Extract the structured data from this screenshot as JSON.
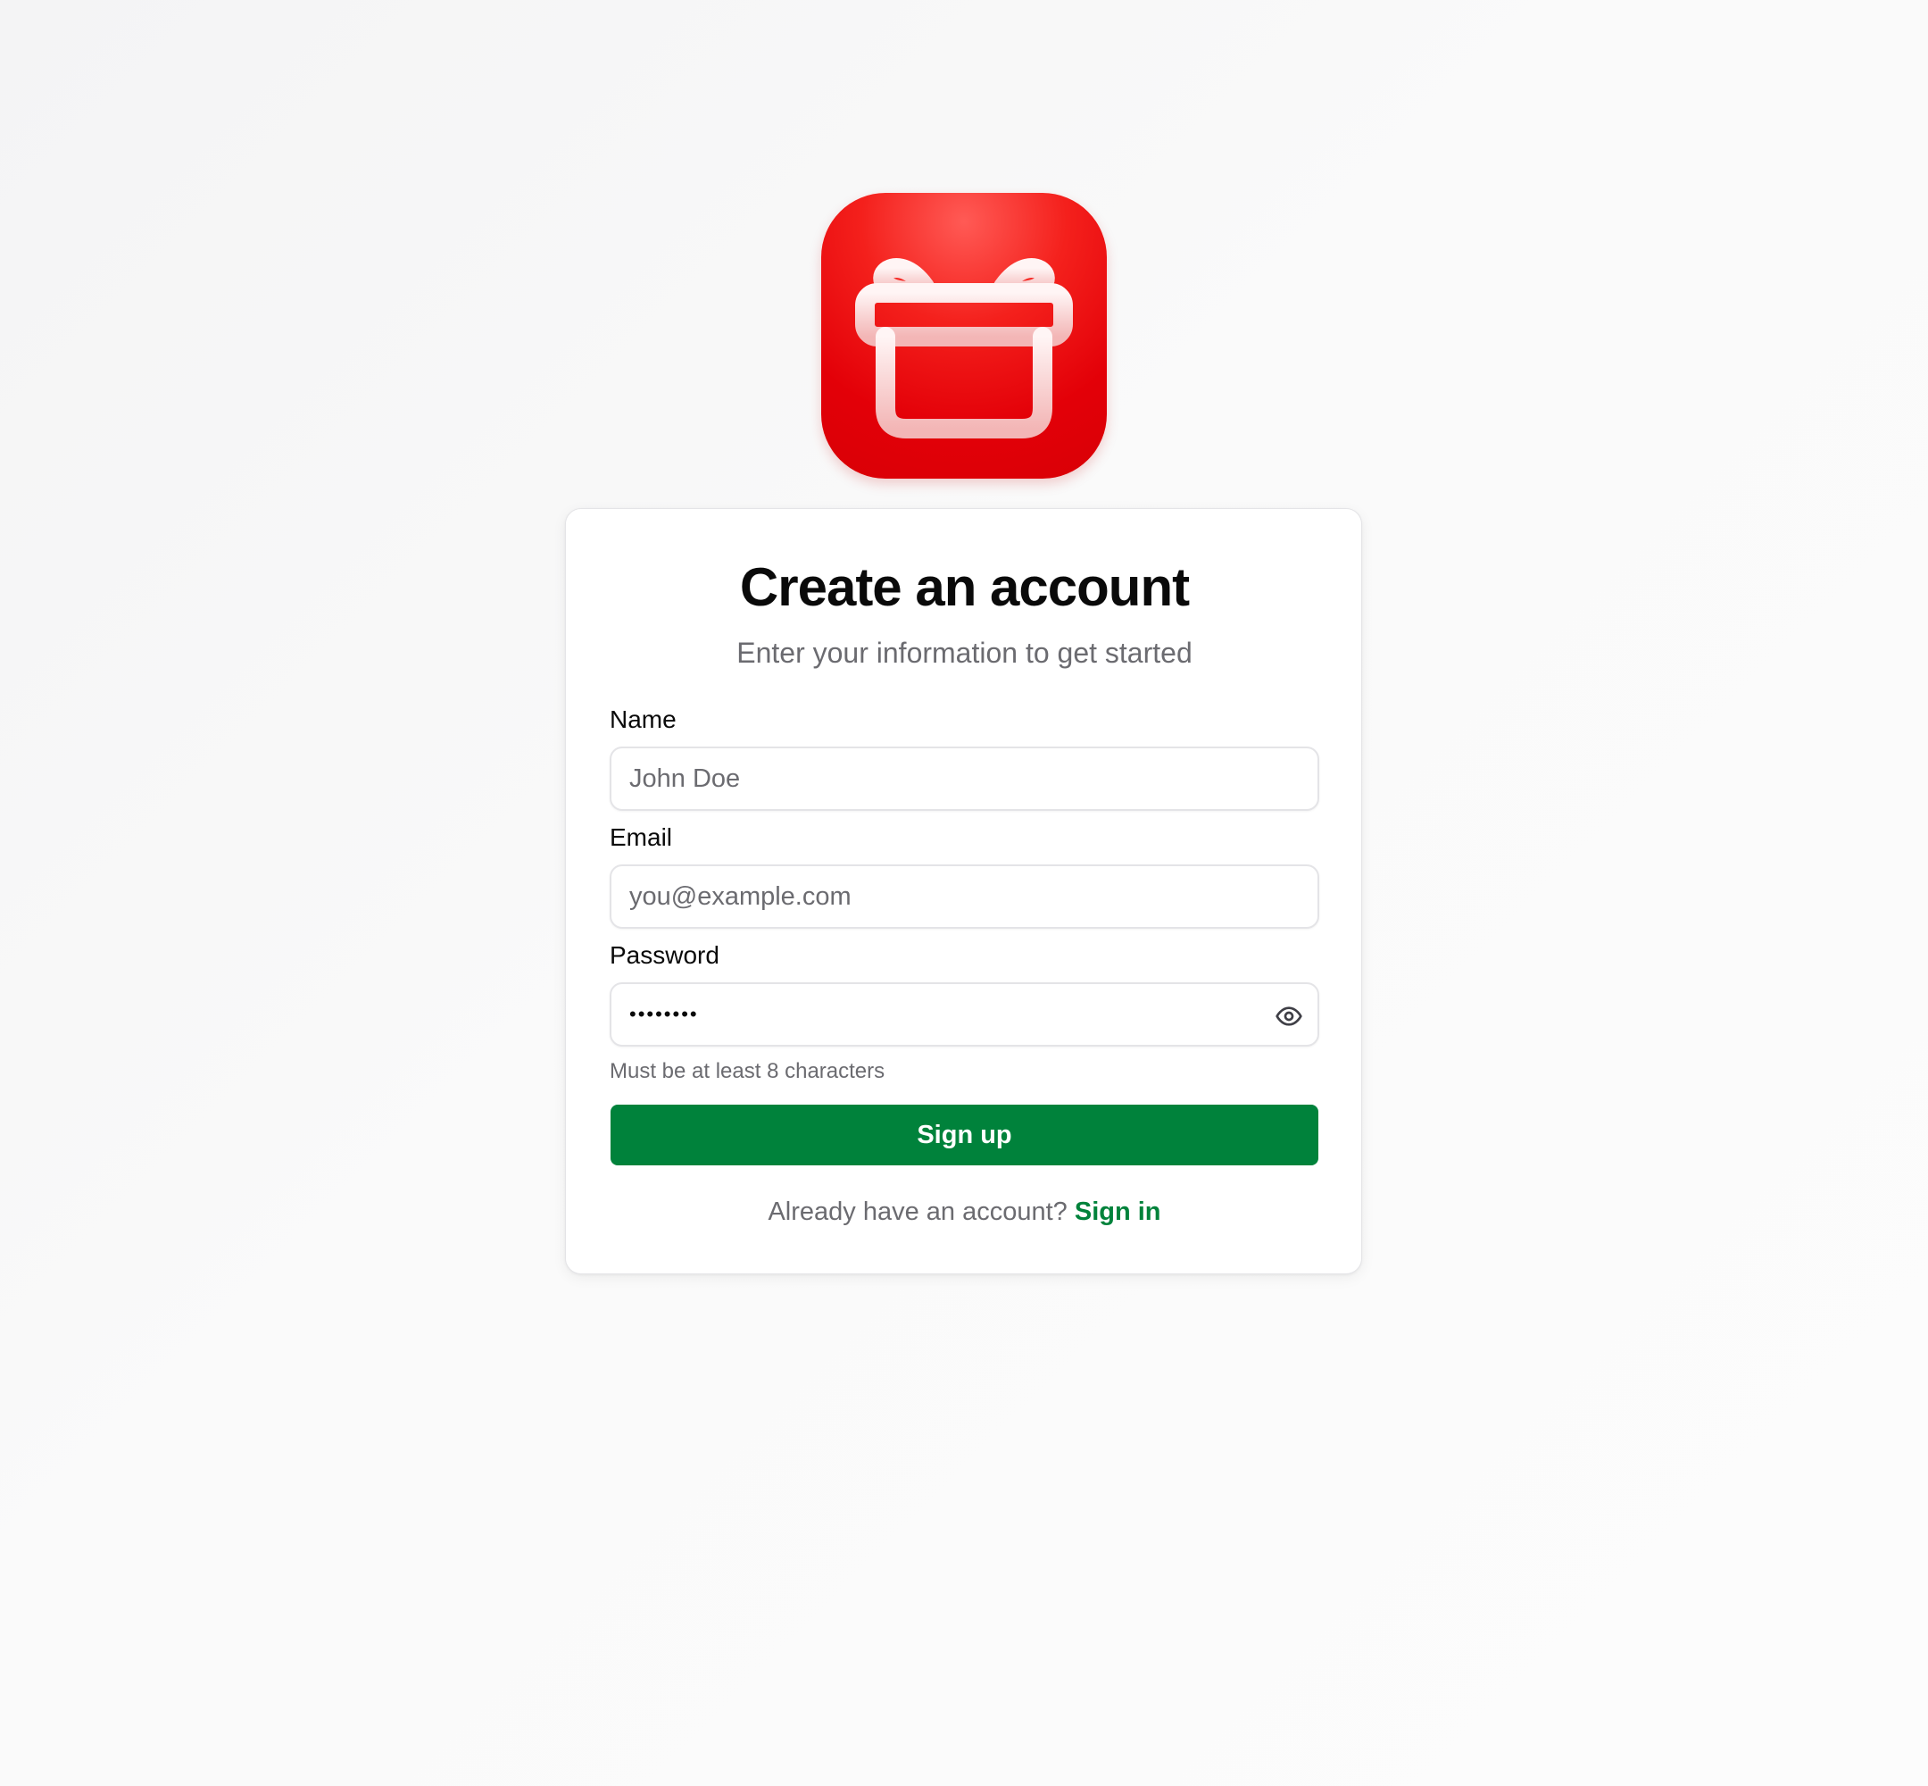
{
  "logo": {
    "icon": "gift-icon",
    "background_color": "#e30008"
  },
  "form": {
    "title": "Create an account",
    "subtitle": "Enter your information to get started",
    "name": {
      "label": "Name",
      "placeholder": "John Doe",
      "value": ""
    },
    "email": {
      "label": "Email",
      "placeholder": "you@example.com",
      "value": ""
    },
    "password": {
      "label": "Password",
      "value": "••••••••",
      "toggle_icon": "eye-icon",
      "hint": "Must be at least 8 characters"
    },
    "submit_label": "Sign up",
    "footer_text": "Already have an account?",
    "footer_link": "Sign in"
  },
  "colors": {
    "accent": "#00823b",
    "brand_red": "#e30008",
    "muted_text": "#6b6b70",
    "border": "#e4e4e7"
  }
}
